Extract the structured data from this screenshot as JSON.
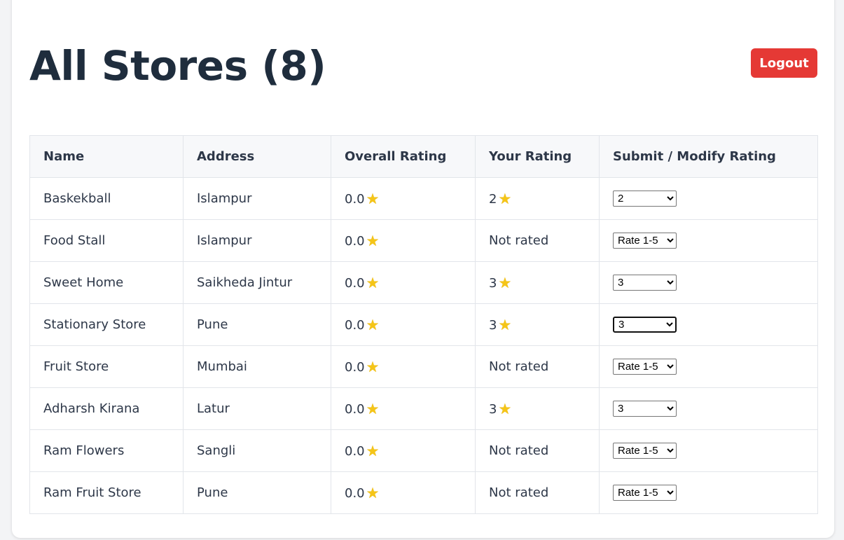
{
  "header": {
    "title": "All Stores (8)",
    "logout_label": "Logout"
  },
  "table": {
    "columns": [
      "Name",
      "Address",
      "Overall Rating",
      "Your Rating",
      "Submit / Modify Rating"
    ],
    "rows": [
      {
        "name": "Baskekball",
        "address": "Islampur",
        "overall": "0.0",
        "your": "2",
        "select_value": "2"
      },
      {
        "name": "Food Stall",
        "address": "Islampur",
        "overall": "0.0",
        "your": "Not rated",
        "select_value": "Rate 1-5"
      },
      {
        "name": "Sweet Home",
        "address": "Saikheda Jintur",
        "overall": "0.0",
        "your": "3",
        "select_value": "3"
      },
      {
        "name": "Stationary Store",
        "address": "Pune",
        "overall": "0.0",
        "your": "3",
        "select_value": "3"
      },
      {
        "name": "Fruit Store",
        "address": "Mumbai",
        "overall": "0.0",
        "your": "Not rated",
        "select_value": "Rate 1-5"
      },
      {
        "name": "Adharsh Kirana",
        "address": "Latur",
        "overall": "0.0",
        "your": "3",
        "select_value": "3"
      },
      {
        "name": "Ram Flowers",
        "address": "Sangli",
        "overall": "0.0",
        "your": "Not rated",
        "select_value": "Rate 1-5"
      },
      {
        "name": "Ram Fruit Store",
        "address": "Pune",
        "overall": "0.0",
        "your": "Not rated",
        "select_value": "Rate 1-5"
      }
    ]
  },
  "star_glyph": "★",
  "icons": {
    "rating": "star-icon"
  },
  "colors": {
    "title": "#1f2d3d",
    "logout_bg": "#e53935",
    "star": "#f5c518",
    "header_bg": "#f7f8fa"
  }
}
